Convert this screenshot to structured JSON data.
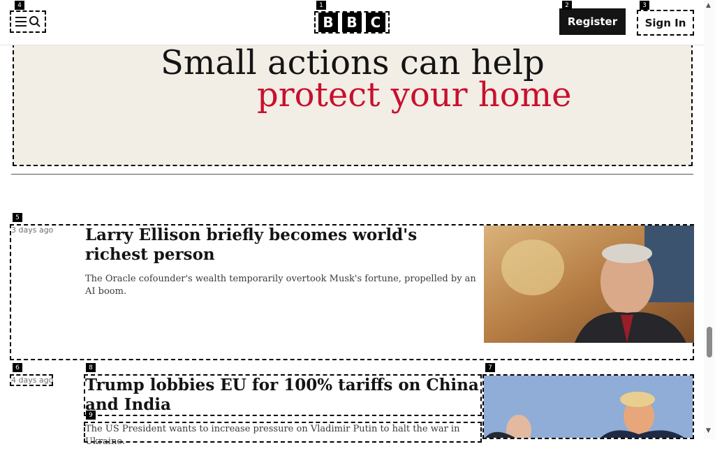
{
  "header": {
    "logo_letters": [
      "B",
      "B",
      "C"
    ],
    "register_label": "Register",
    "signin_label": "Sign In"
  },
  "ad": {
    "line1": "Small actions can help",
    "line2": "protect your home",
    "accent_color": "#c8102e",
    "background": "#f2ede5"
  },
  "articles": [
    {
      "timestamp": "3 days ago",
      "headline": "Larry Ellison briefly becomes world's richest person",
      "summary": "The Oracle cofounder's wealth temporarily overtook Musk's fortune, propelled by an AI boom.",
      "image_icon": "portrait-photo"
    },
    {
      "timestamp": "4 days ago",
      "headline": "Trump lobbies EU for 100% tariffs on China and India",
      "summary": "The US President wants to increase pressure on Vladimir Putin to halt the war in Ukraine.",
      "image_icon": "two-leaders-photo"
    }
  ],
  "markers": [
    "1",
    "2",
    "3",
    "4",
    "5",
    "6",
    "7",
    "8",
    "9"
  ],
  "scrollbar": {
    "up_icon": "▲",
    "down_icon": "▼"
  }
}
